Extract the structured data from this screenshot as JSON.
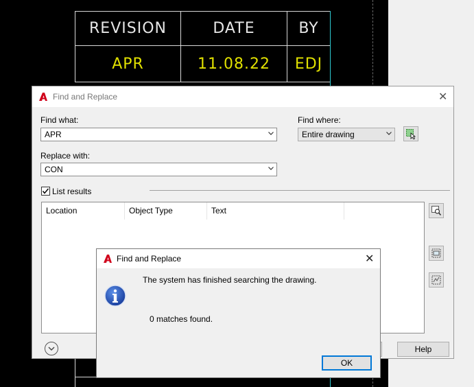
{
  "title_block": {
    "headers": [
      "REVISION",
      "DATE",
      "BY"
    ],
    "values": [
      "APR",
      "11.08.22",
      "EDJ"
    ]
  },
  "find_replace": {
    "title": "Find and Replace",
    "find_what_label": "Find what:",
    "find_what_value": "APR",
    "replace_with_label": "Replace with:",
    "replace_with_value": "CON",
    "find_where_label": "Find where:",
    "find_where_value": "Entire drawing",
    "list_results_label": "List results",
    "list_results_checked": true,
    "columns": [
      "Location",
      "Object Type",
      "Text"
    ],
    "help_label": "Help"
  },
  "message_box": {
    "title": "Find and Replace",
    "line1": "The system has finished searching the drawing.",
    "line2": "0 matches found.",
    "ok_label": "OK"
  },
  "icons": {
    "app_logo": "autocad-logo-icon",
    "close": "close-icon",
    "info": "info-icon",
    "select_objects": "select-objects-icon",
    "zoom_to_selected": "zoom-to-selected-icon",
    "create_selection": "create-selection-icon",
    "select_all": "select-all-icon",
    "expand": "chevron-down-icon"
  },
  "colors": {
    "cad_background": "#000000",
    "title_block_text": "#e6e6e6",
    "title_block_value": "#e0e000",
    "title_block_edge": "#2ecbd3",
    "focus_blue": "#0078d7",
    "dialog_bg": "#f0f0f0"
  }
}
